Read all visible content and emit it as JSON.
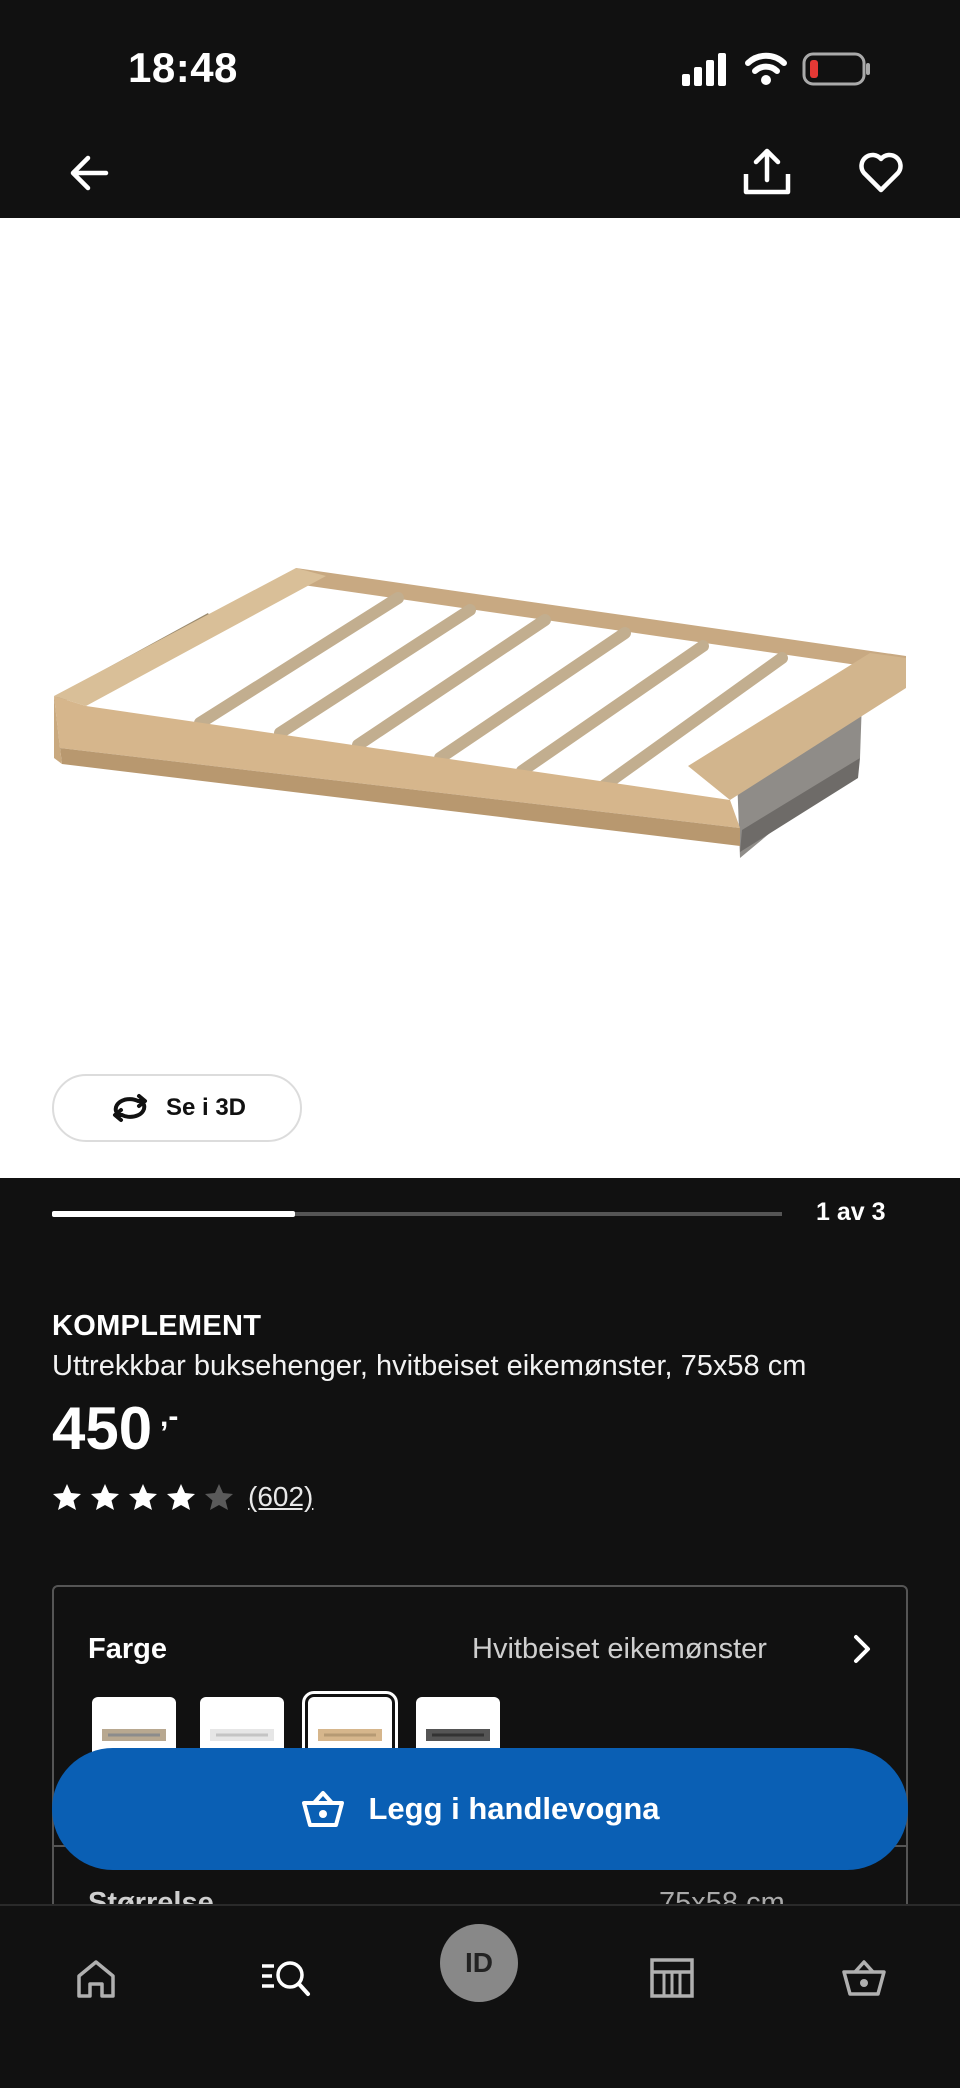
{
  "status_bar": {
    "time": "18:48"
  },
  "carousel": {
    "page_indicator": "1 av 3",
    "progress": 0.333
  },
  "view_3d_label": "Se i 3D",
  "product": {
    "name": "KOMPLEMENT",
    "description": "Uttrekkbar buksehenger, hvitbeiset eikemønster, 75x58 cm",
    "price": "450",
    "price_suffix": ",-",
    "rating": 4,
    "rating_max": 5,
    "rating_count": "(602)"
  },
  "options": {
    "color_label": "Farge",
    "color_value": "Hvitbeiset eikemønster",
    "size_label": "Størrelse",
    "size_value": "75x58 cm",
    "swatch_selected_index": 2
  },
  "cart_button_label": "Legg i handlevogna",
  "nav": {
    "id_label": "ID"
  },
  "colors": {
    "accent": "#0a5fb4",
    "background": "#111111"
  }
}
